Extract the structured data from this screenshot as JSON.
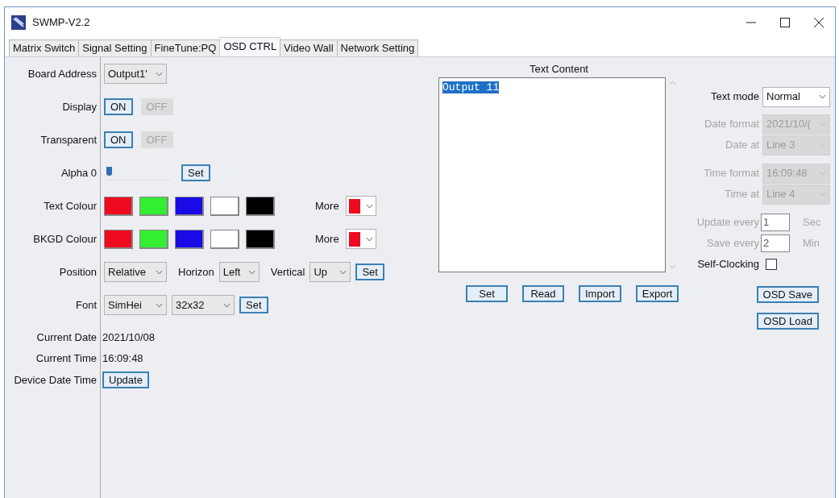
{
  "window": {
    "title": "SWMP-V2.2"
  },
  "tabs": [
    {
      "label": "Matrix Switch",
      "selected": false
    },
    {
      "label": "Signal Setting",
      "selected": false
    },
    {
      "label": "FineTune:PQ",
      "selected": false
    },
    {
      "label": "OSD CTRL",
      "selected": true
    },
    {
      "label": "Video Wall",
      "selected": false
    },
    {
      "label": "Network Setting",
      "selected": false
    }
  ],
  "board_address": {
    "label": "Board Address",
    "value": "Output1'"
  },
  "toggles": [
    {
      "label": "Display",
      "options": [
        {
          "label": "ON",
          "selected": true
        },
        {
          "label": "OFF",
          "selected": false
        }
      ]
    },
    {
      "label": "Transparent",
      "options": [
        {
          "label": "ON",
          "selected": true
        },
        {
          "label": "OFF",
          "selected": false
        }
      ]
    }
  ],
  "alpha": {
    "label": "Alpha 0",
    "level": 0.02,
    "button": "Set"
  },
  "colour_rows": [
    {
      "label": "Text Colour",
      "swatches": [
        {
          "color": "#ee0a1f"
        },
        {
          "color": "#33ee33"
        },
        {
          "color": "#1a0ae6"
        },
        {
          "color": "#ffffff"
        },
        {
          "color": "#000000"
        }
      ],
      "more": {
        "label": "More",
        "color": "#ee0a1f"
      }
    },
    {
      "label": "BKGD Colour",
      "swatches": [
        {
          "color": "#ee0a1f"
        },
        {
          "color": "#33ee33"
        },
        {
          "color": "#1a0ae6"
        },
        {
          "color": "#ffffff"
        },
        {
          "color": "#000000"
        }
      ],
      "more": {
        "label": "More",
        "color": "#ee0a1f"
      }
    }
  ],
  "position": {
    "label": "Position",
    "value": "Relative",
    "horizon_label": "Horizon",
    "horizon_value": "Left",
    "vertical_label": "Vertical",
    "vertical_value": "Up",
    "button": "Set"
  },
  "font": {
    "label": "Font",
    "family": "SimHei",
    "size": "32x32",
    "button": "Set"
  },
  "info": [
    {
      "label": "Current Date",
      "value": "2021/10/08",
      "kind": "text"
    },
    {
      "label": "Current Time",
      "value": "16:09:48",
      "kind": "text"
    },
    {
      "label": "Device Date Time",
      "value": "Update",
      "kind": "button"
    }
  ],
  "text_content": {
    "title": "Text Content",
    "value": "Output 11",
    "selected": true
  },
  "content_buttons": [
    "Set",
    "Read",
    "Import",
    "Export"
  ],
  "text_mode": {
    "label": "Text mode",
    "value": "Normal"
  },
  "format_fields": [
    {
      "label": "Date format",
      "value": "2021/10/(",
      "disabled": true
    },
    {
      "label": "Date at",
      "value": "Line  3",
      "disabled": true
    },
    {
      "label": "Time format",
      "value": "16:09:48",
      "disabled": true
    },
    {
      "label": "Time at",
      "value": "Line  4",
      "disabled": true
    }
  ],
  "intervals": [
    {
      "label": "Update every",
      "value": "1",
      "unit": "Sec",
      "disabled": true
    },
    {
      "label": "Save every",
      "value": "2",
      "unit": "Min",
      "disabled": true
    }
  ],
  "self_clocking": {
    "label": "Self-Clocking",
    "checked": false
  },
  "osd_buttons": [
    "OSD Save",
    "OSD Load"
  ]
}
